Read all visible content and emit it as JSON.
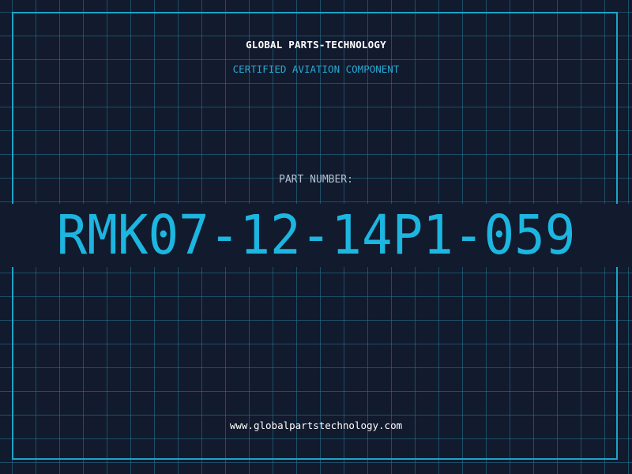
{
  "header": {
    "company_name": "GLOBAL PARTS-TECHNOLOGY",
    "subtitle": "CERTIFIED AVIATION COMPONENT"
  },
  "part": {
    "label": "PART NUMBER:",
    "number": "RMK07-12-14P1-059"
  },
  "footer": {
    "website": "www.globalpartstechnology.com"
  },
  "colors": {
    "background": "#121a2e",
    "grid": "#1f5f78",
    "accent": "#1cb6e0",
    "frame": "#1da3c8"
  }
}
